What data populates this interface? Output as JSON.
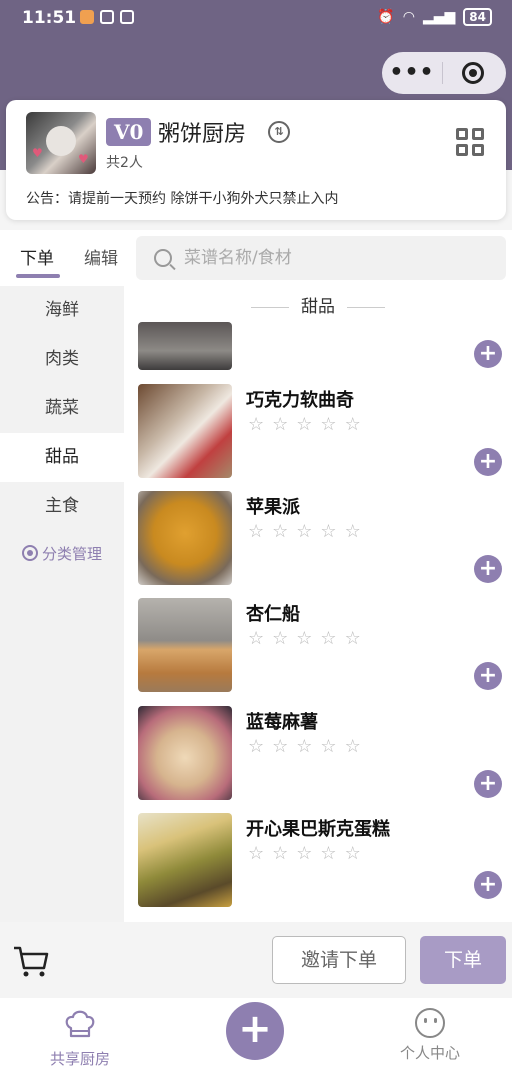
{
  "statusbar": {
    "time": "11:51",
    "battery": "84"
  },
  "capsule": {
    "more": "•••"
  },
  "kitchen": {
    "badge": "V0",
    "name": "粥饼厨房",
    "members": "共2人",
    "notice": "公告：请提前一天预约 除饼干小狗外犬只禁止入内"
  },
  "tabs": {
    "order": "下单",
    "edit": "编辑"
  },
  "search": {
    "placeholder": "菜谱名称/食材"
  },
  "categories": [
    "海鲜",
    "肉类",
    "蔬菜",
    "甜品",
    "主食"
  ],
  "category_manage": "分类管理",
  "section_title": "甜品",
  "items": [
    {
      "name": "巧克力软曲奇",
      "rating": 0
    },
    {
      "name": "苹果派",
      "rating": 0
    },
    {
      "name": "杏仁船",
      "rating": 0
    },
    {
      "name": "蓝莓麻薯",
      "rating": 0
    },
    {
      "name": "开心果巴斯克蛋糕",
      "rating": 0
    }
  ],
  "cart": {
    "invite": "邀请下单",
    "order": "下单"
  },
  "tabbar": {
    "left": "共享厨房",
    "right": "个人中心"
  },
  "colors": {
    "accent": "#8e7fb0",
    "header": "#6f6484"
  }
}
